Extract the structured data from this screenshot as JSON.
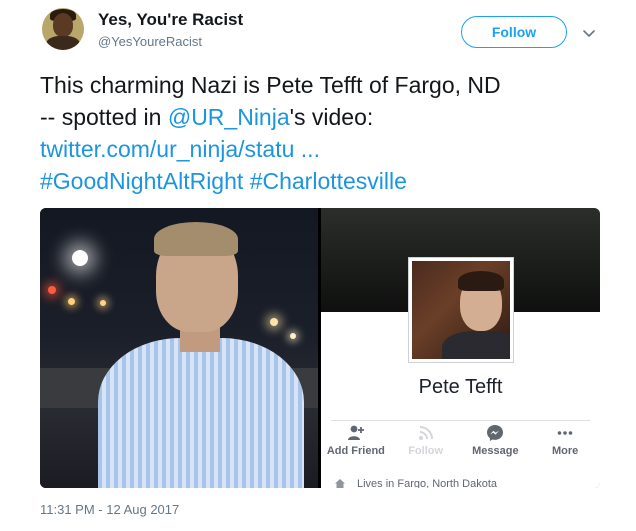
{
  "tweet": {
    "display_name": "Yes, You're Racist",
    "handle": "@YesYoureRacist",
    "follow_label": "Follow",
    "text_segments": {
      "line1": "This charming Nazi is Pete Tefft of Fargo, ND",
      "line2_prefix": "-- spotted in ",
      "mention": "@UR_Ninja",
      "line2_suffix": "'s video:",
      "url": "twitter.com/ur_ninja/statu ...",
      "hashtag1": "#GoodNightAltRight",
      "hashtag2": "#Charlottesville"
    },
    "timestamp": "11:31 PM - 12 Aug 2017"
  },
  "facebook_card": {
    "profile_name": "Pete Tefft",
    "actions": [
      {
        "label": "Add Friend",
        "icon": "add-friend-icon"
      },
      {
        "label": "Follow",
        "icon": "follow-rss-icon"
      },
      {
        "label": "Message",
        "icon": "messenger-icon"
      },
      {
        "label": "More",
        "icon": "more-dots-icon"
      }
    ],
    "lives_in": "Lives in Fargo, North Dakota"
  },
  "colors": {
    "link": "#1b95e0",
    "follow_accent": "#1da1f2",
    "secondary_text": "#657786"
  }
}
